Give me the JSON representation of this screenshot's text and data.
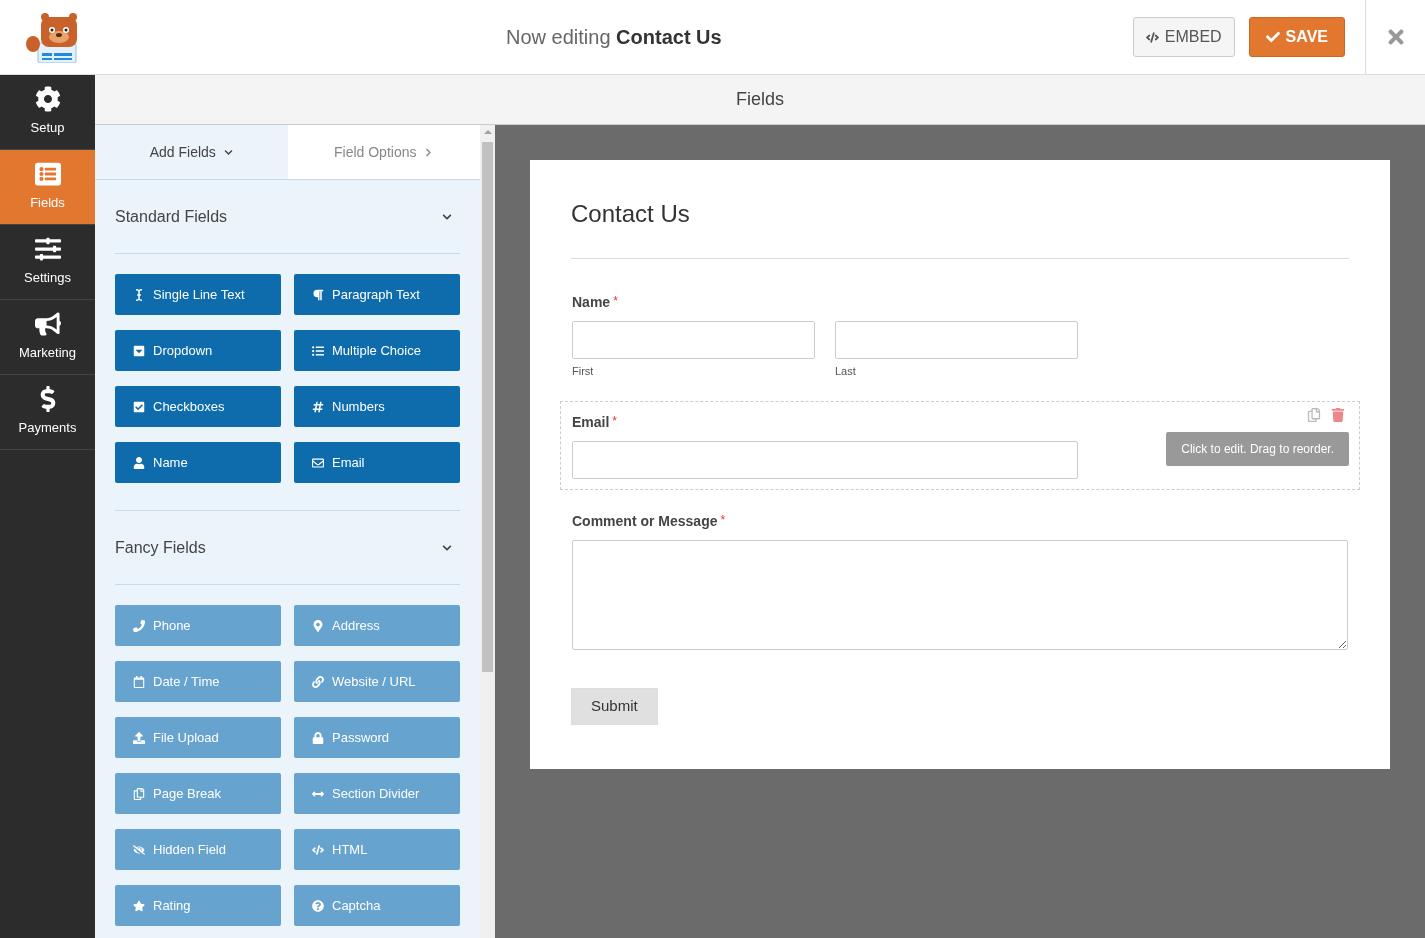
{
  "header": {
    "title_prefix": "Now editing",
    "title_name": "Contact Us",
    "embed_label": "EMBED",
    "save_label": "SAVE"
  },
  "sidebar": {
    "items": [
      {
        "label": "Setup",
        "selected": false
      },
      {
        "label": "Fields",
        "selected": true
      },
      {
        "label": "Settings",
        "selected": false
      },
      {
        "label": "Marketing",
        "selected": false
      },
      {
        "label": "Payments",
        "selected": false
      }
    ]
  },
  "topbar": {
    "title": "Fields"
  },
  "panel": {
    "tabs": [
      {
        "label": "Add Fields",
        "selected": true
      },
      {
        "label": "Field Options",
        "selected": false
      }
    ],
    "groups": [
      {
        "title": "Standard Fields",
        "kind": "standard",
        "expanded": true,
        "fields": [
          "Single Line Text",
          "Paragraph Text",
          "Dropdown",
          "Multiple Choice",
          "Checkboxes",
          "Numbers",
          "Name",
          "Email"
        ]
      },
      {
        "title": "Fancy Fields",
        "kind": "fancy",
        "expanded": true,
        "fields": [
          "Phone",
          "Address",
          "Date / Time",
          "Website / URL",
          "File Upload",
          "Password",
          "Page Break",
          "Section Divider",
          "Hidden Field",
          "HTML",
          "Rating",
          "Captcha"
        ]
      }
    ]
  },
  "form": {
    "title": "Contact Us",
    "fields": [
      {
        "kind": "name",
        "label": "Name",
        "required_mark": "*",
        "selected": false,
        "sublabels": [
          "First",
          "Last"
        ]
      },
      {
        "kind": "email",
        "label": "Email",
        "required_mark": "*",
        "selected": true,
        "hint": "Click to edit. Drag to reorder."
      },
      {
        "kind": "textarea",
        "label": "Comment or Message",
        "required_mark": "*",
        "selected": false
      }
    ],
    "submit": "Submit"
  }
}
